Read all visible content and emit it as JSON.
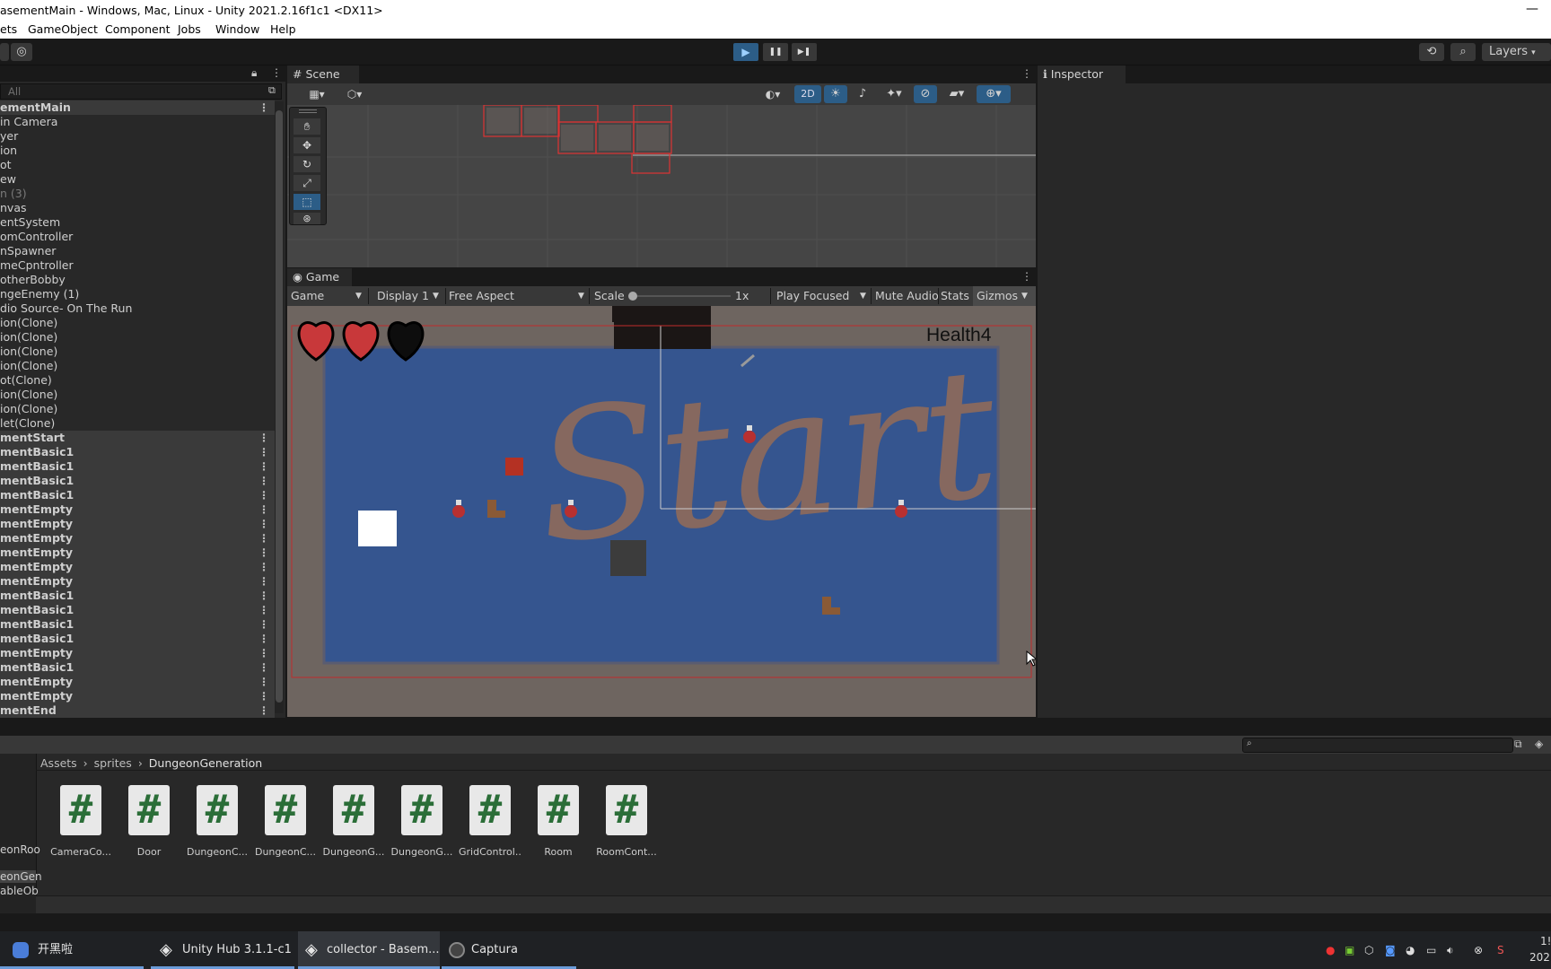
{
  "window": {
    "title": "asementMain - Windows, Mac, Linux - Unity 2021.2.16f1c1 <DX11>",
    "minimize": "—"
  },
  "menu": [
    "ets",
    "GameObject",
    "Component",
    "Jobs",
    "Window",
    "Help"
  ],
  "toolbar": {
    "play": "▶",
    "pause": "❚❚",
    "step": "▶❚",
    "history_icon": "history-icon",
    "search_icon": "search-icon",
    "layers_label": "Layers"
  },
  "hierarchy": {
    "search_placeholder": "All",
    "rows": [
      {
        "label": "ementMain",
        "scene": true
      },
      {
        "label": "in Camera"
      },
      {
        "label": "yer"
      },
      {
        "label": "ion"
      },
      {
        "label": "ot"
      },
      {
        "label": "ew"
      },
      {
        "label": "n (3)",
        "faded": true
      },
      {
        "label": "nvas"
      },
      {
        "label": "entSystem"
      },
      {
        "label": "omController"
      },
      {
        "label": "nSpawner"
      },
      {
        "label": "meCpntroller"
      },
      {
        "label": "otherBobby"
      },
      {
        "label": "ngeEnemy (1)"
      },
      {
        "label": "dio Source- On The Run"
      },
      {
        "label": "ion(Clone)"
      },
      {
        "label": "ion(Clone)"
      },
      {
        "label": "ion(Clone)"
      },
      {
        "label": "ion(Clone)"
      },
      {
        "label": "ot(Clone)"
      },
      {
        "label": "ion(Clone)"
      },
      {
        "label": "ion(Clone)"
      },
      {
        "label": "let(Clone)"
      },
      {
        "label": "mentStart",
        "scene": true
      },
      {
        "label": "mentBasic1",
        "scene": true
      },
      {
        "label": "mentBasic1",
        "scene": true
      },
      {
        "label": "mentBasic1",
        "scene": true
      },
      {
        "label": "mentBasic1",
        "scene": true
      },
      {
        "label": "mentEmpty",
        "scene": true
      },
      {
        "label": "mentEmpty",
        "scene": true
      },
      {
        "label": "mentEmpty",
        "scene": true
      },
      {
        "label": "mentEmpty",
        "scene": true
      },
      {
        "label": "mentEmpty",
        "scene": true
      },
      {
        "label": "mentEmpty",
        "scene": true
      },
      {
        "label": "mentBasic1",
        "scene": true
      },
      {
        "label": "mentBasic1",
        "scene": true
      },
      {
        "label": "mentBasic1",
        "scene": true
      },
      {
        "label": "mentBasic1",
        "scene": true
      },
      {
        "label": "mentEmpty",
        "scene": true
      },
      {
        "label": "mentBasic1",
        "scene": true
      },
      {
        "label": "mentEmpty",
        "scene": true
      },
      {
        "label": "mentEmpty",
        "scene": true
      },
      {
        "label": "mentEnd",
        "scene": true
      }
    ]
  },
  "scene": {
    "tab_label": "Scene",
    "mode_2d": "2D"
  },
  "game": {
    "tab_label": "Game",
    "view_select": "Game",
    "display_select": "Display 1",
    "aspect_select": "Free Aspect",
    "scale_label": "Scale",
    "scale_value": "1x",
    "play_focused": "Play Focused",
    "mute_audio": "Mute Audio",
    "stats": "Stats",
    "gizmos": "Gizmos",
    "health_text": "Health4",
    "start_text": "Start",
    "hearts_full": 2,
    "hearts_total": 3
  },
  "inspector": {
    "tab_label": "Inspector"
  },
  "project": {
    "breadcrumb": [
      "Assets",
      "sprites",
      "DungeonGeneration"
    ],
    "side_items": [
      "eonRoo",
      "eonGen",
      "ableOb"
    ],
    "assets": [
      "CameraCo...",
      "Door",
      "DungeonC...",
      "DungeonC...",
      "DungeonG...",
      "DungeonG...",
      "GridControl...",
      "Room",
      "RoomCont..."
    ],
    "asset_glyph": "#"
  },
  "taskbar": {
    "items": [
      {
        "label": "开黑啦",
        "icon": "kaiheila-icon"
      },
      {
        "label": "Unity Hub 3.1.1-c1",
        "icon": "unity-icon"
      },
      {
        "label": "collector - Basem...",
        "icon": "unity-icon",
        "active": true
      },
      {
        "label": "Captura",
        "icon": "captura-icon"
      }
    ],
    "clock_top": "1!",
    "clock_bottom": "202"
  },
  "colors": {
    "accent_blue": "#2c5d87",
    "game_floor": "#35558f",
    "game_wall": "#6e6560",
    "heart_red": "#c8383a"
  }
}
